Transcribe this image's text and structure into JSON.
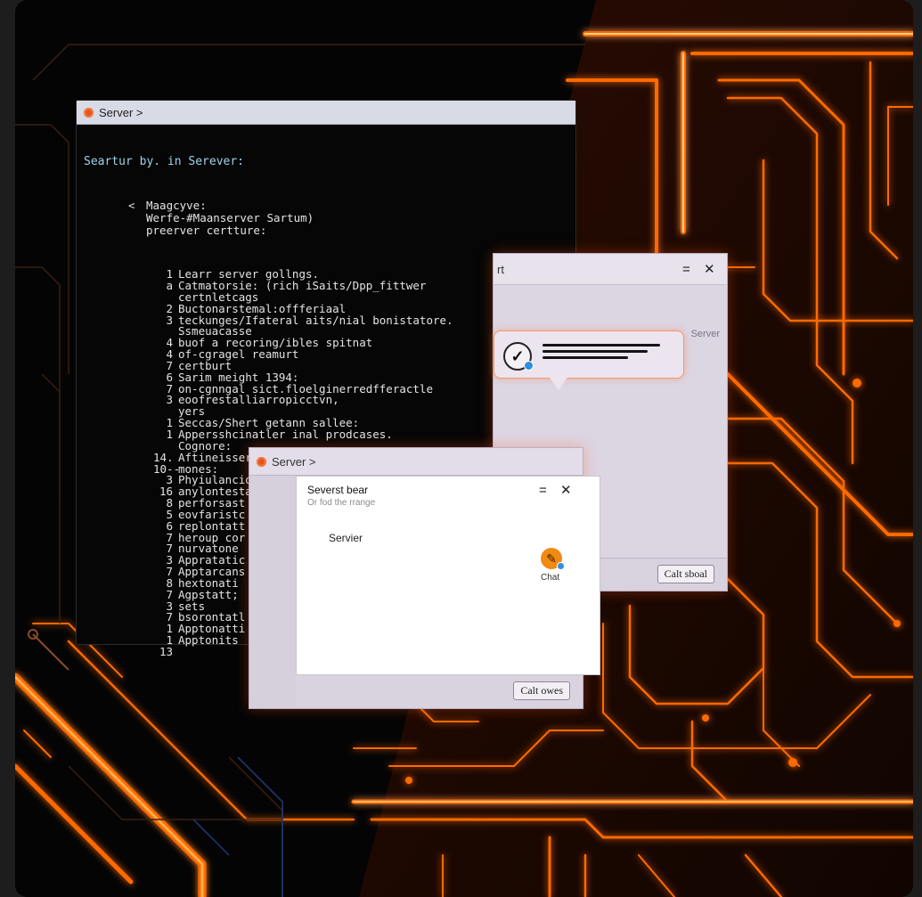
{
  "terminal": {
    "title": "Server >",
    "prompt": "Seartur by. in Serever:",
    "header": [
      "Maagcyve:",
      "Werfe-#Maanserver Sartum)",
      "preerver certture:"
    ],
    "back_glyph": "<",
    "lines": [
      {
        "n": "1",
        "t": "Learr server gollngs."
      },
      {
        "n": "a",
        "t": "Catmatorsie: (rich iSaits/Dpp_fittwer"
      },
      {
        "n": "",
        "t": "certnletcags"
      },
      {
        "n": "2",
        "t": "Buctonarstemal:offferiaal"
      },
      {
        "n": "3",
        "t": "teckunges/Ifateral aits/nial bonistatore."
      },
      {
        "n": "",
        "t": "Ssmeuacasse"
      },
      {
        "n": "4",
        "t": "buof a recoring/ibles spitnat"
      },
      {
        "n": "4",
        "t": "of-cgragel reamurt"
      },
      {
        "n": "7",
        "t": "certburt"
      },
      {
        "n": "6",
        "t": "Sarim meight 1394:"
      },
      {
        "n": "7",
        "t": "on-cgnngal sict.floelginerredfferactle"
      },
      {
        "n": "3",
        "t": "eoofrestalliarropicctvn,"
      },
      {
        "n": "",
        "t": "yers"
      },
      {
        "n": "1",
        "t": "Seccas/Shert getann sallee:"
      },
      {
        "n": "1",
        "t": "Appersshcinatler inal prodcases."
      },
      {
        "n": "",
        "t": "Cognore:"
      },
      {
        "n": "14.",
        "t": "Aftineissergline,formatattles/fecmerise"
      },
      {
        "n": "10--",
        "t": "mones:"
      },
      {
        "n": "3",
        "t": "Phyiulancion,"
      },
      {
        "n": "16",
        "t": "anylontesta, llst Sorllestaction."
      },
      {
        "n": "8",
        "t": "perforsast"
      },
      {
        "n": "5",
        "t": "eovfaristc"
      },
      {
        "n": "6",
        "t": "replontatt"
      },
      {
        "n": "7",
        "t": "heroup cor"
      },
      {
        "n": "7",
        "t": "nurvatone"
      },
      {
        "n": "3",
        "t": "Appratatic"
      },
      {
        "n": "7",
        "t": "Apptarcans"
      },
      {
        "n": "8",
        "t": "hextonati"
      },
      {
        "n": "7",
        "t": "Agpstatt;"
      },
      {
        "n": "3",
        "t": "sets"
      },
      {
        "n": "7",
        "t": "bsorontatl"
      },
      {
        "n": "1",
        "t": "Apptonatti"
      },
      {
        "n": "1",
        "t": "Apptonits"
      },
      {
        "n": "13",
        "t": ""
      }
    ]
  },
  "dialog_top": {
    "title": "rt",
    "side_label": "Server",
    "menu_glyph": "=",
    "close_glyph": "✕",
    "avatar_glyph": "✓",
    "button": "Calt sboal"
  },
  "dialog_bottom": {
    "title": "Server >",
    "inner_title": "Severst bear",
    "inner_subtitle": "Or fod the rrange",
    "label": "Servier",
    "menu_glyph": "=",
    "close_glyph": "✕",
    "chat_glyph": "✎",
    "chat_label": "Chat",
    "button": "Calt owes"
  },
  "colors": {
    "neon": "#ff6a00",
    "neon_core": "#ffb04a",
    "terminal_bg": "#060606"
  }
}
